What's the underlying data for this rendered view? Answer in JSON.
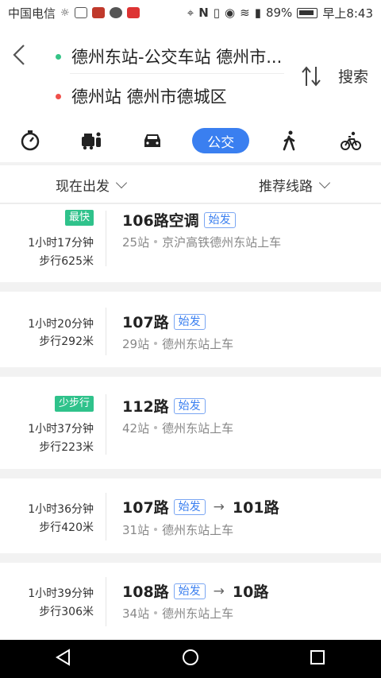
{
  "status": {
    "carrier": "中国电信",
    "battery": "89%",
    "time": "早上8:43"
  },
  "header": {
    "start": "德州东站-公交车站 德州市...",
    "end": "德州站 德州市德城区",
    "search_label": "搜索",
    "start_dot_color": "#35c487",
    "end_dot_color": "#f0504a"
  },
  "modes": {
    "active_label": "公交",
    "items": [
      "timer",
      "taxi",
      "car",
      "bus",
      "walk",
      "bike"
    ]
  },
  "filters": {
    "depart": "现在出发",
    "sort": "推荐线路"
  },
  "routes": [
    {
      "tag": "最快",
      "duration": "1小时17分钟",
      "walk": "步行625米",
      "bus": "106路空调",
      "badge": "始发",
      "bus2": "",
      "stops": "25站",
      "board": "京沪高铁德州东站上车"
    },
    {
      "tag": "",
      "duration": "1小时20分钟",
      "walk": "步行292米",
      "bus": "107路",
      "badge": "始发",
      "bus2": "",
      "stops": "29站",
      "board": "德州东站上车"
    },
    {
      "tag": "少步行",
      "duration": "1小时37分钟",
      "walk": "步行223米",
      "bus": "112路",
      "badge": "始发",
      "bus2": "",
      "stops": "42站",
      "board": "德州东站上车"
    },
    {
      "tag": "",
      "duration": "1小时36分钟",
      "walk": "步行420米",
      "bus": "107路",
      "badge": "始发",
      "bus2": "101路",
      "stops": "31站",
      "board": "德州东站上车"
    },
    {
      "tag": "",
      "duration": "1小时39分钟",
      "walk": "步行306米",
      "bus": "108路",
      "badge": "始发",
      "bus2": "10路",
      "stops": "34站",
      "board": "德州东站上车"
    }
  ]
}
